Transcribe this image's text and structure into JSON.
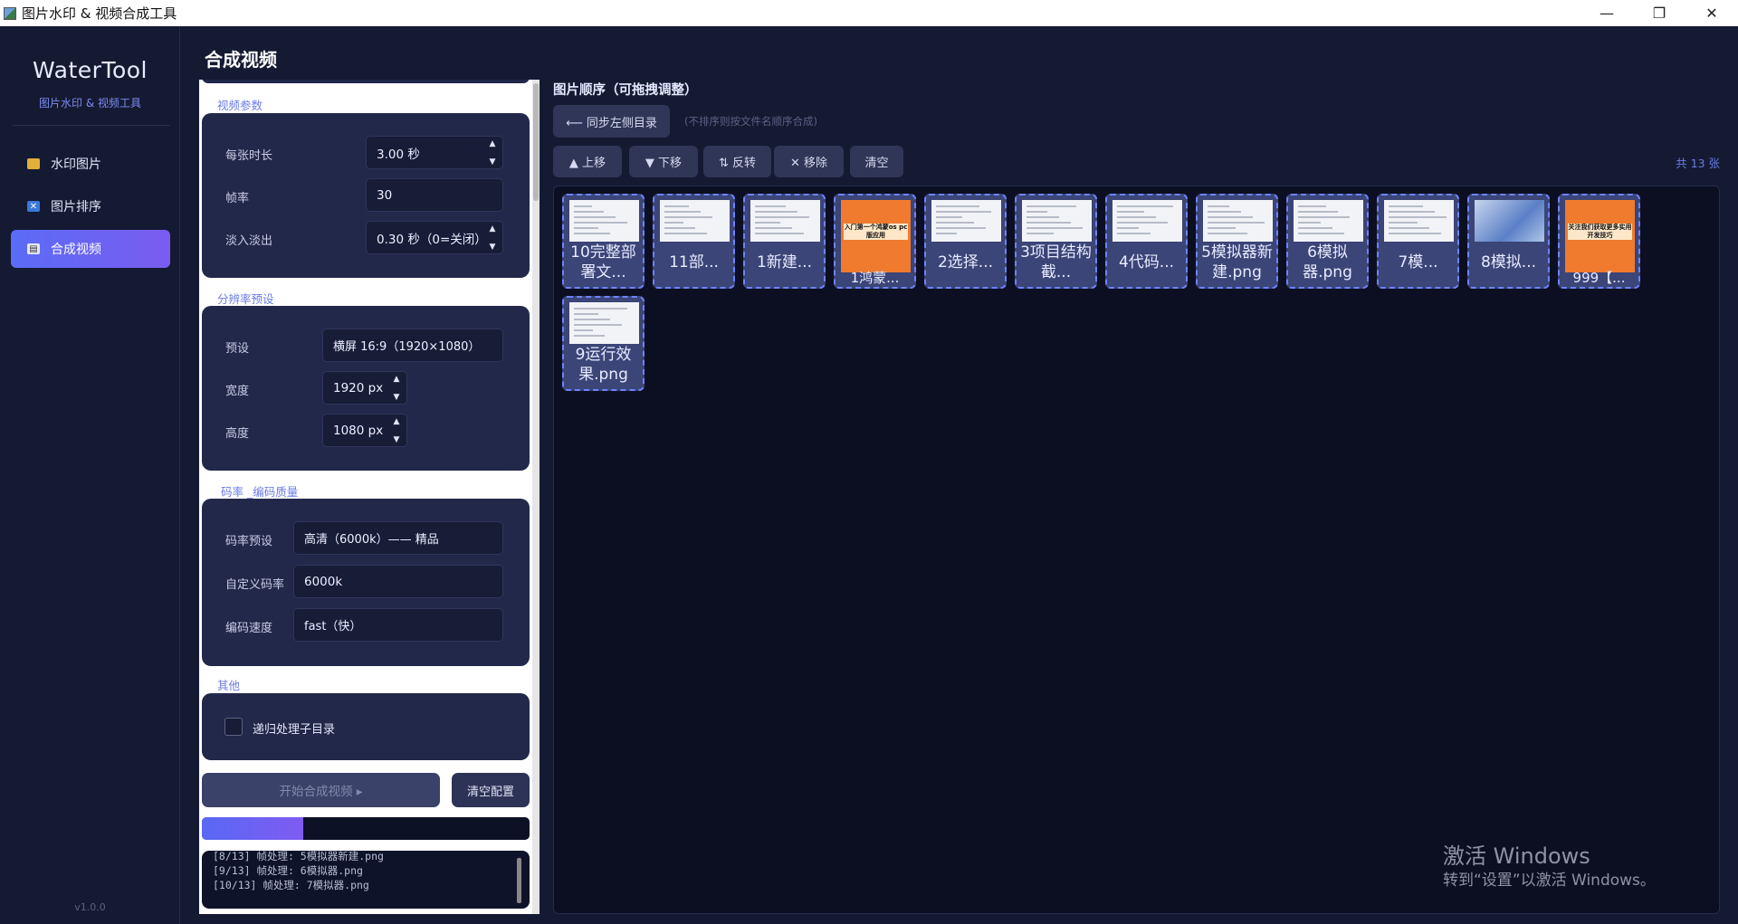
{
  "window": {
    "title": "图片水印 & 视频合成工具",
    "minimize": "—",
    "maximize": "❐",
    "close": "✕"
  },
  "sidebar": {
    "brand": "WaterTool",
    "subtitle": "图片水印 & 视频工具",
    "items": [
      {
        "label": "水印图片",
        "icon": "image-icon"
      },
      {
        "label": "图片排序",
        "icon": "shuffle-icon"
      },
      {
        "label": "合成视频",
        "icon": "video-icon",
        "active": true
      }
    ],
    "version": "v1.0.0"
  },
  "page": {
    "title": "合成视频"
  },
  "settings": {
    "video_section": "视频参数",
    "duration_label": "每张时长",
    "duration_value": "3.00 秒",
    "fps_label": "帧率",
    "fps_value": "30",
    "fade_label": "淡入淡出",
    "fade_value": "0.30 秒（0=关闭）",
    "resolution_section": "分辨率预设",
    "preset_label": "预设",
    "preset_value": "横屏 16:9（1920×1080）",
    "width_label": "宽度",
    "width_value": "1920 px",
    "height_label": "高度",
    "height_value": "1080 px",
    "bitrate_section": "码率 _编码质量",
    "bitrate_preset_label": "码率预设",
    "bitrate_preset_value": "高清（6000k）—— 精品",
    "custom_bitrate_label": "自定义码率",
    "custom_bitrate_value": "6000k",
    "encode_speed_label": "编码速度",
    "encode_speed_value": "fast（快）",
    "other_section": "其他",
    "recursive_label": "递归处理子目录",
    "recursive_checked": false,
    "start_button": "开始合成视频 ▸",
    "clear_button": "清空配置",
    "progress_percent": 31,
    "log_lines": [
      "[8/13] 帧处理: 5模拟器新建.png",
      "[9/13] 帧处理: 6模拟器.png",
      "[10/13] 帧处理: 7模拟器.png"
    ]
  },
  "order": {
    "title": "图片顺序（可拖拽调整）",
    "sync_button": "⟵ 同步左侧目录",
    "sync_hint": "(不排序则按文件名顺序合成)",
    "buttons": {
      "up": "▲ 上移",
      "down": "▼ 下移",
      "reverse": "⇅ 反转",
      "remove": "✕ 移除",
      "clear": "清空"
    },
    "count": "共 13 张",
    "thumbs": [
      {
        "caption": "10完整部署文...",
        "kind": "doc"
      },
      {
        "caption": "11部...",
        "kind": "doc"
      },
      {
        "caption": "1新建...",
        "kind": "doc"
      },
      {
        "caption": "1鸿蒙...",
        "kind": "orange",
        "poster_text": "入门第一个鸿蒙os pc版应用"
      },
      {
        "caption": "2选择...",
        "kind": "doc"
      },
      {
        "caption": "3项目结构截...",
        "kind": "doc"
      },
      {
        "caption": "4代码...",
        "kind": "doc"
      },
      {
        "caption": "5模拟器新建.png",
        "kind": "doc"
      },
      {
        "caption": "6模拟器.png",
        "kind": "doc"
      },
      {
        "caption": "7模...",
        "kind": "doc"
      },
      {
        "caption": "8模拟...",
        "kind": "blue"
      },
      {
        "caption": "999【...",
        "kind": "orange",
        "poster_text": "关注我们获取更多实用开发技巧"
      },
      {
        "caption": "9运行效果.png",
        "kind": "doc"
      }
    ]
  },
  "os_watermark": {
    "line1": "激活 Windows",
    "line2": "转到“设置”以激活 Windows。"
  },
  "colors": {
    "accent": "#6b7ce8",
    "active_nav": "#5b6cf6",
    "background": "#151a33",
    "panel": "#22284a"
  }
}
